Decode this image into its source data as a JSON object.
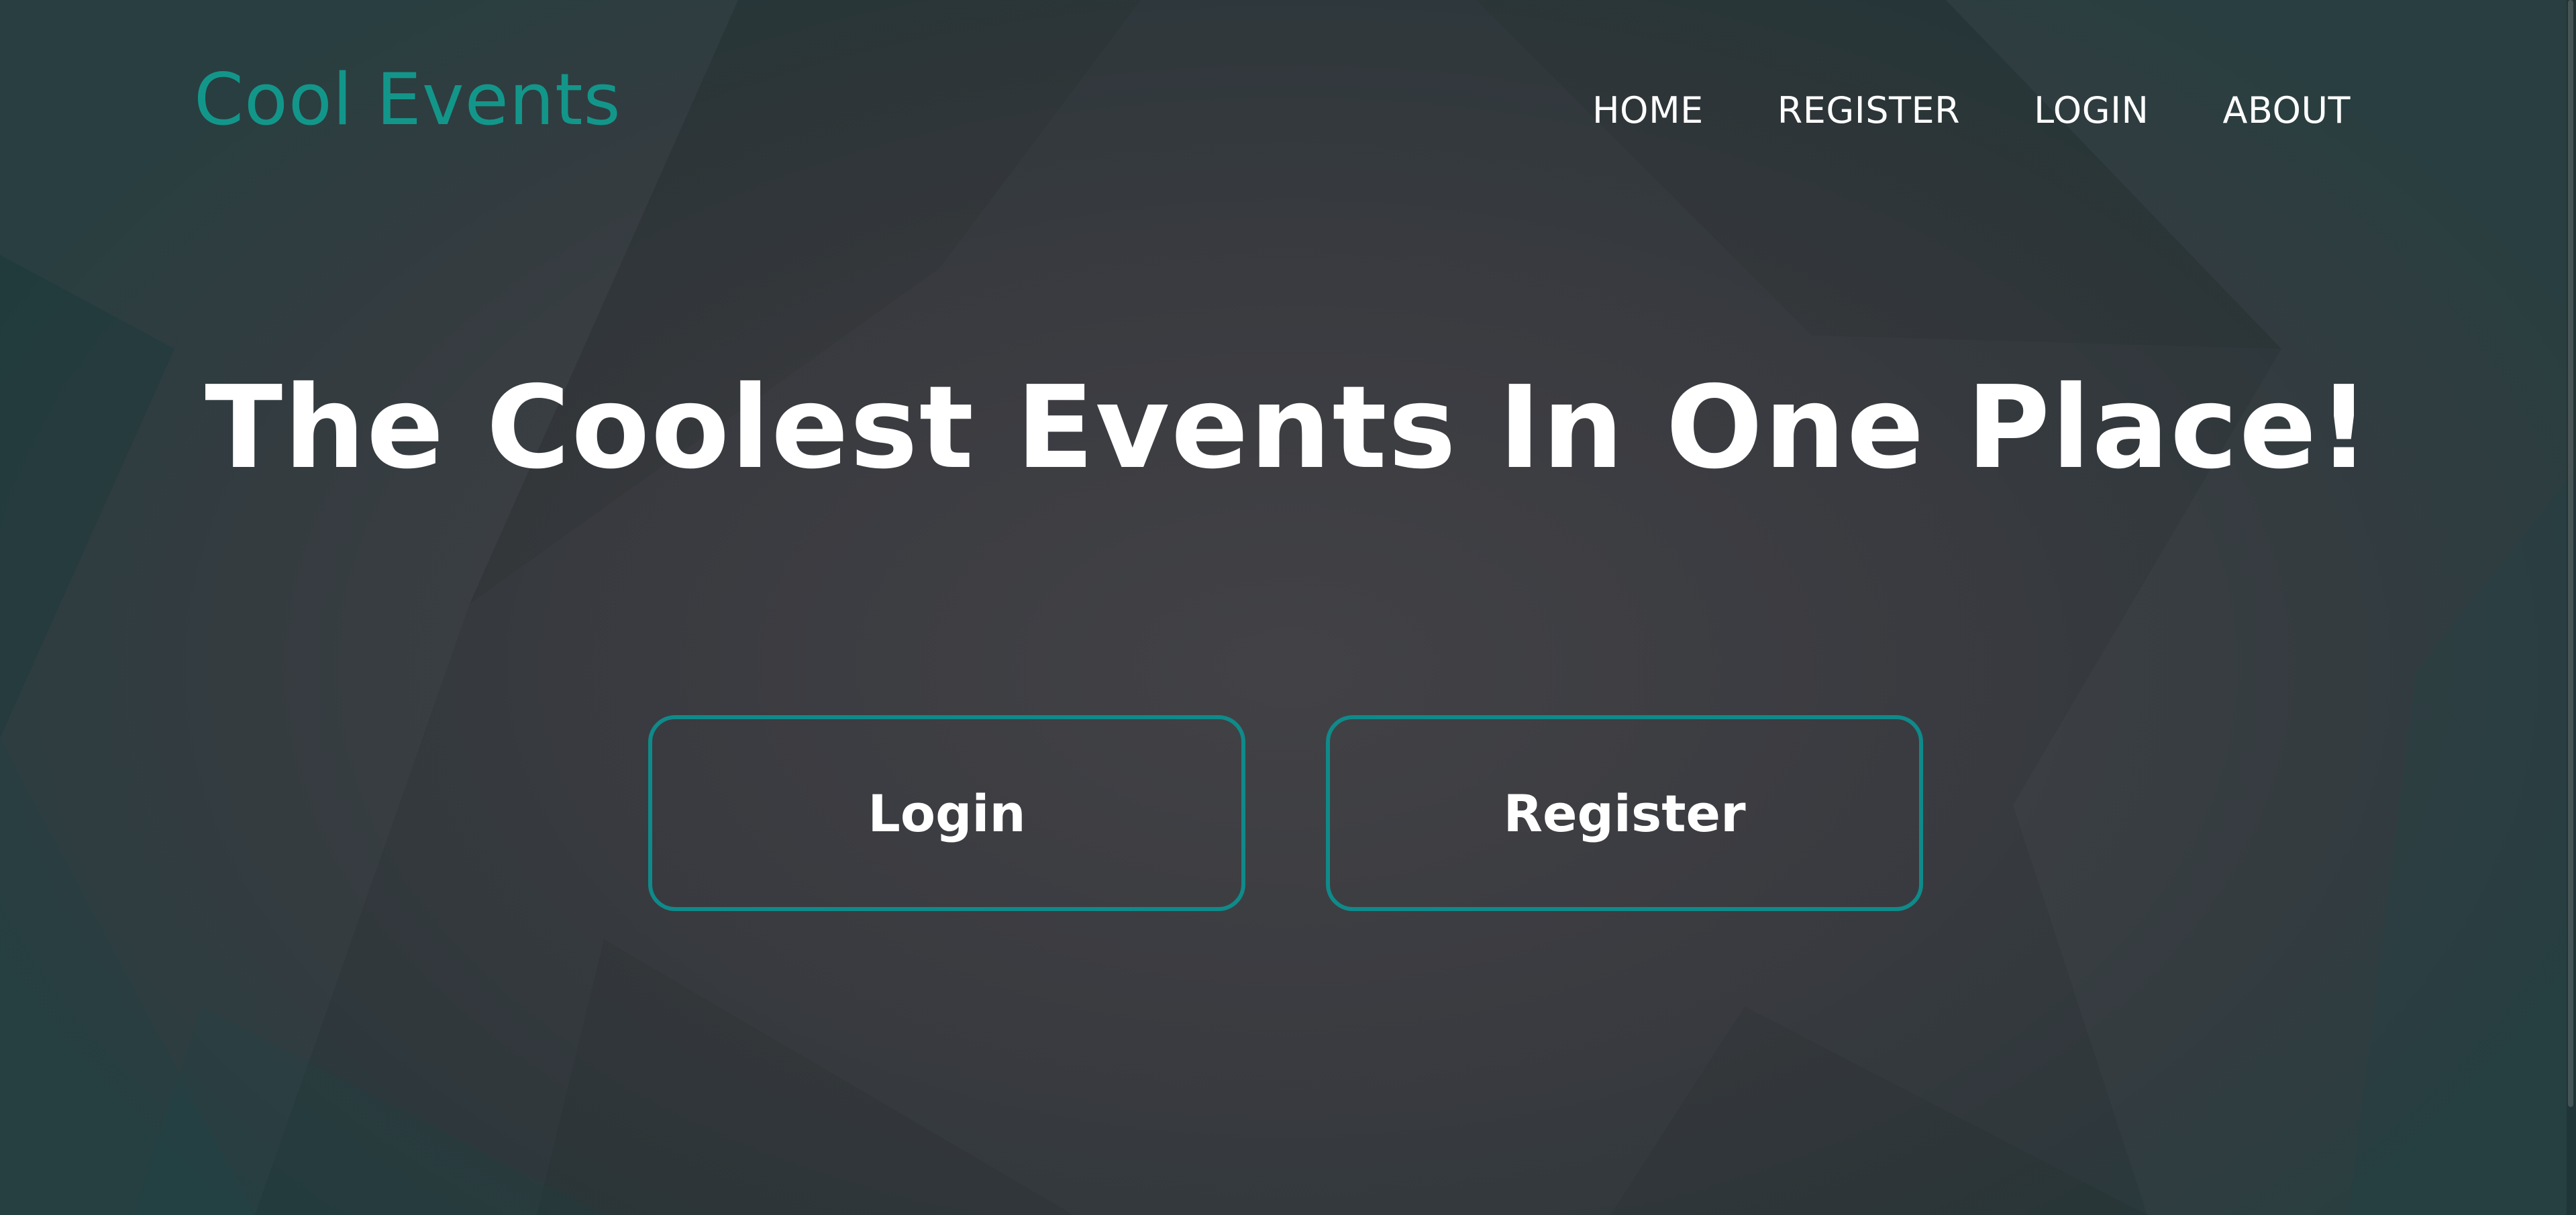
{
  "brand": {
    "name": "Cool Events",
    "color": "#13968a"
  },
  "nav": {
    "items": [
      {
        "label": "HOME"
      },
      {
        "label": "REGISTER"
      },
      {
        "label": "LOGIN"
      },
      {
        "label": "ABOUT"
      }
    ]
  },
  "hero": {
    "title": "The Coolest Events In One Place!",
    "login_label": "Login",
    "register_label": "Register",
    "button_border_color": "#0f8a8a"
  },
  "colors": {
    "background": "#3a3b40",
    "text": "#ffffff",
    "accent": "#13968a"
  }
}
